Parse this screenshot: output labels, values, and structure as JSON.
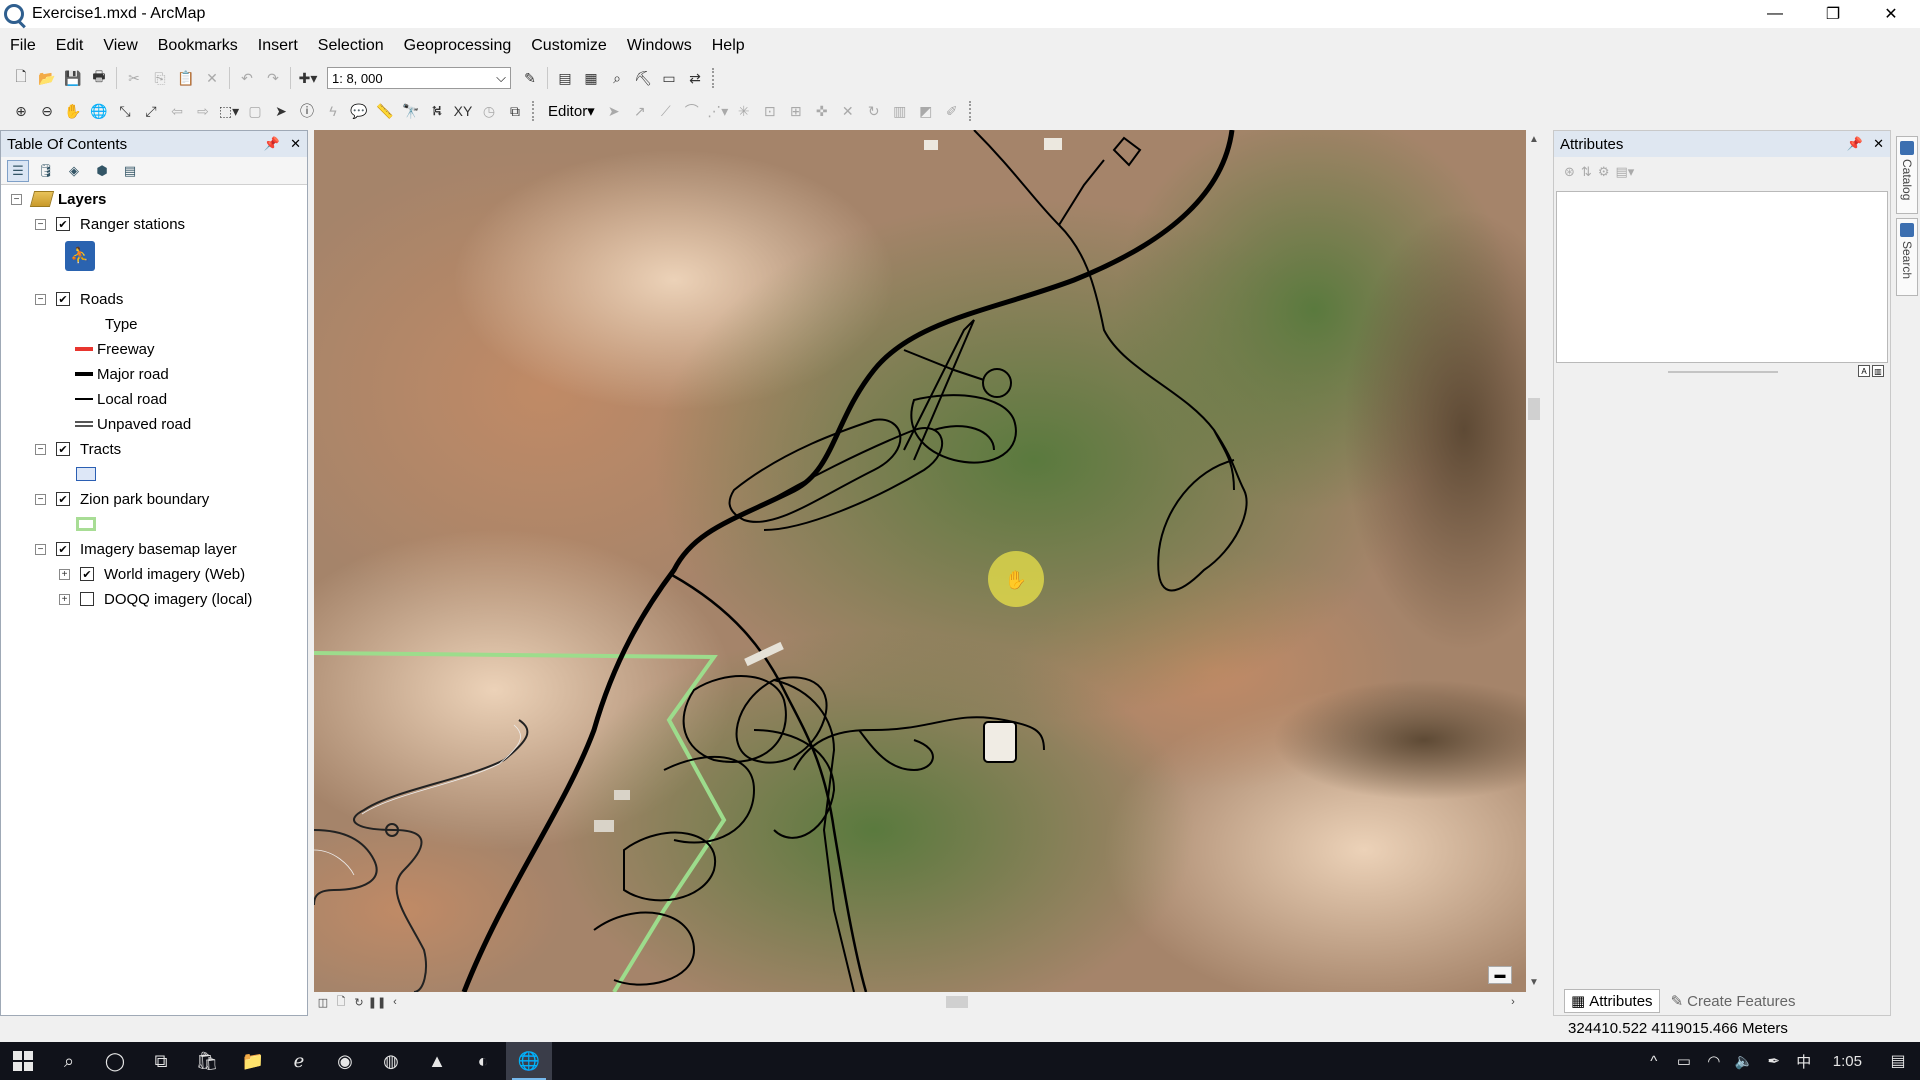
{
  "window": {
    "title": "Exercise1.mxd - ArcMap",
    "minimize": "—",
    "restore": "❐",
    "close": "✕"
  },
  "menu": [
    "File",
    "Edit",
    "View",
    "Bookmarks",
    "Insert",
    "Selection",
    "Geoprocessing",
    "Customize",
    "Windows",
    "Help"
  ],
  "toolbar": {
    "scale_value": "1: 8, 000",
    "editor_label": "Editor▾"
  },
  "toc": {
    "title": "Table Of Contents",
    "root": "Layers",
    "layers": [
      {
        "name": "Ranger stations",
        "checked": true
      },
      {
        "name": "Roads",
        "checked": true,
        "field": "Type",
        "classes": [
          {
            "label": "Freeway",
            "color": "#e8352e"
          },
          {
            "label": "Major road",
            "color": "#000000"
          },
          {
            "label": "Local road",
            "color": "#000000"
          },
          {
            "label": "Unpaved road",
            "color": "#555555"
          }
        ]
      },
      {
        "name": "Tracts",
        "checked": true
      },
      {
        "name": "Zion park boundary",
        "checked": true
      },
      {
        "name": "Imagery basemap layer",
        "checked": true,
        "children": [
          {
            "name": "World imagery (Web)",
            "checked": true
          },
          {
            "name": "DOQQ imagery (local)",
            "checked": false
          }
        ]
      }
    ]
  },
  "attributes": {
    "title": "Attributes",
    "tabs": [
      "Attributes",
      "Create Features"
    ]
  },
  "side_tabs": [
    "Catalog",
    "Search"
  ],
  "status": {
    "coords": "324410.522  4119015.466 Meters"
  },
  "taskbar": {
    "time": "1:05",
    "ime": "中"
  },
  "colors": {
    "boundary_green": "#9ddc8c",
    "road_black": "#000000",
    "cursor_yellow": "#e9e24a",
    "panel_header": "#dfe7f1"
  }
}
